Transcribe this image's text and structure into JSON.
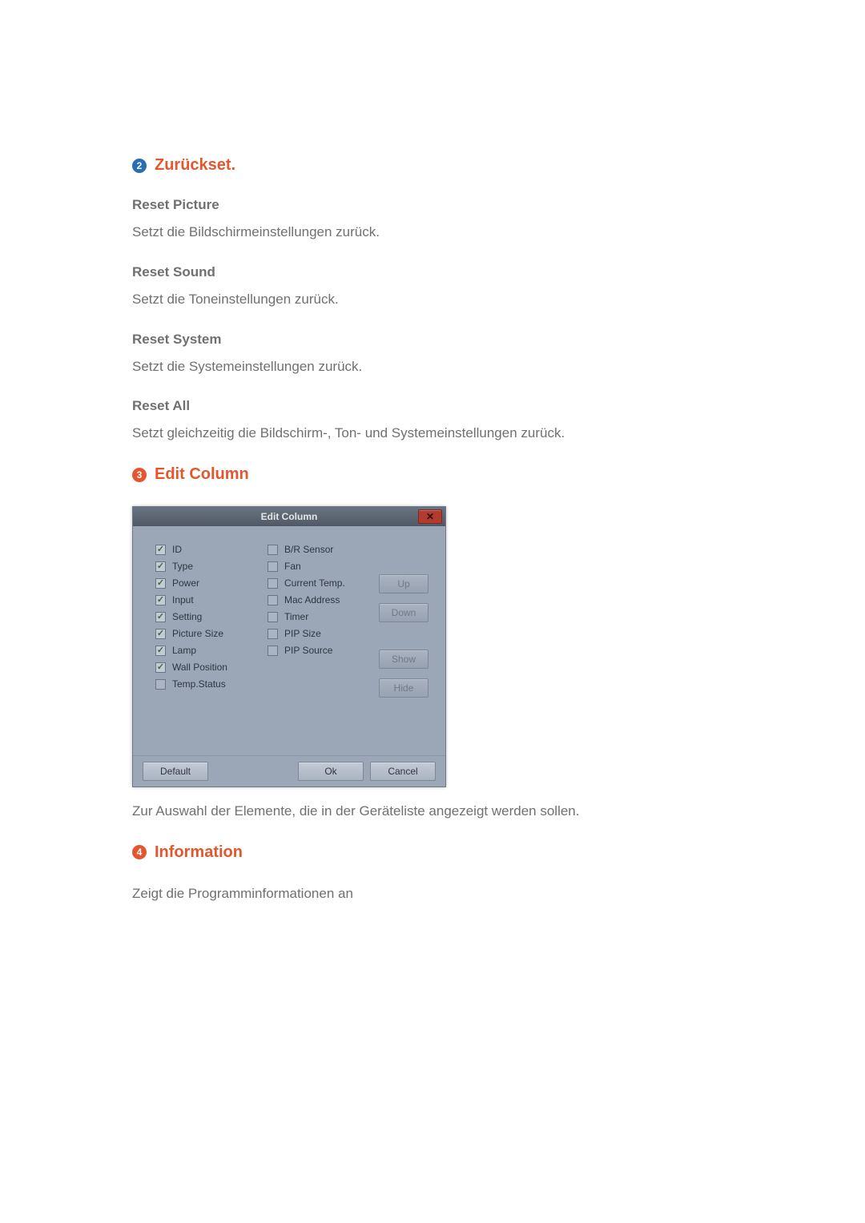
{
  "section2": {
    "badge": "2",
    "heading": "Zurückset.",
    "items": [
      {
        "title": "Reset Picture",
        "desc": "Setzt die Bildschirmeinstellungen zurück."
      },
      {
        "title": "Reset Sound",
        "desc": "Setzt die Toneinstellungen zurück."
      },
      {
        "title": "Reset System",
        "desc": "Setzt die Systemeinstellungen zurück."
      },
      {
        "title": "Reset All",
        "desc": "Setzt gleichzeitig die Bildschirm-, Ton- und Systemeinstellungen zurück."
      }
    ]
  },
  "section3": {
    "badge": "3",
    "heading": "Edit Column",
    "caption": "Zur Auswahl der Elemente, die in der Geräteliste angezeigt werden sollen."
  },
  "dialog": {
    "title": "Edit Column",
    "close_glyph": "✕",
    "columns_left": [
      {
        "label": "ID",
        "checked": true
      },
      {
        "label": "Type",
        "checked": true
      },
      {
        "label": "Power",
        "checked": true
      },
      {
        "label": "Input",
        "checked": true
      },
      {
        "label": "Setting",
        "checked": true
      },
      {
        "label": "Picture Size",
        "checked": true
      },
      {
        "label": "Lamp",
        "checked": true
      },
      {
        "label": "Wall Position",
        "checked": true
      },
      {
        "label": "Temp.Status",
        "checked": false
      }
    ],
    "columns_mid": [
      {
        "label": "B/R Sensor",
        "checked": false
      },
      {
        "label": "Fan",
        "checked": false
      },
      {
        "label": "Current Temp.",
        "checked": false
      },
      {
        "label": "Mac Address",
        "checked": false
      },
      {
        "label": "Timer",
        "checked": false
      },
      {
        "label": "PIP Size",
        "checked": false
      },
      {
        "label": "PIP Source",
        "checked": false
      }
    ],
    "side_buttons": {
      "up": "Up",
      "down": "Down",
      "show": "Show",
      "hide": "Hide"
    },
    "footer": {
      "default": "Default",
      "ok": "Ok",
      "cancel": "Cancel"
    }
  },
  "section4": {
    "badge": "4",
    "heading": "Information",
    "desc": "Zeigt die Programminformationen an"
  }
}
